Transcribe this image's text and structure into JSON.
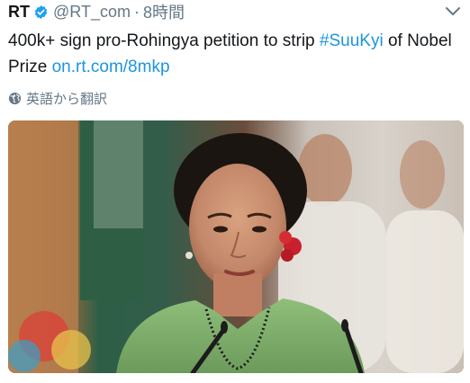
{
  "tweet": {
    "author": "RT",
    "handle": "@RT_com",
    "separator": "·",
    "time": "8時間",
    "text_before": "400k+ sign pro-Rohingya petition to strip ",
    "hashtag": "#SuuKyi",
    "text_after": " of Nobel Prize ",
    "link": "on.rt.com/8mkp",
    "translate_label": "英語から翻訳"
  },
  "icons": {
    "verified": "verified-badge-icon",
    "caret": "chevron-down-icon",
    "translate": "globe-icon"
  },
  "colors": {
    "link": "#1b95e0",
    "verified": "#1da1f2",
    "secondary_text": "#657786"
  }
}
